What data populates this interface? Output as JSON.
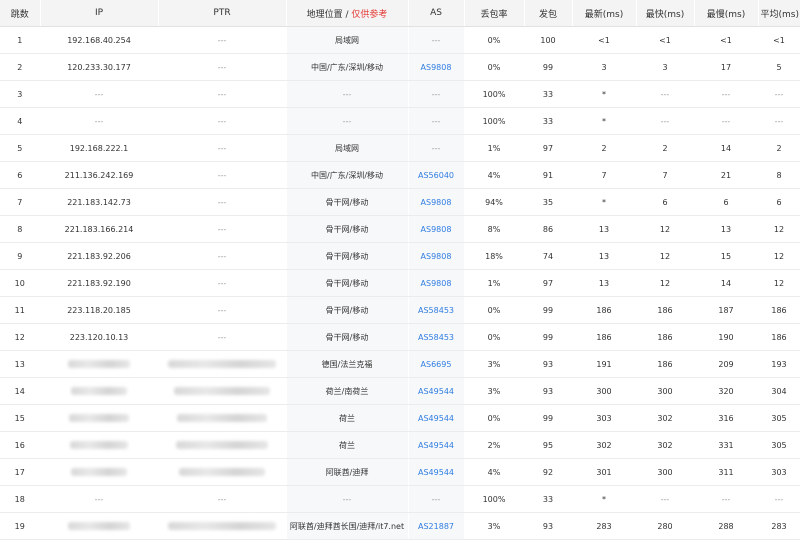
{
  "header": {
    "hop": "跳数",
    "ip": "IP",
    "ptr": "PTR",
    "geo": "地理位置 /",
    "geo_hint": "仅供参考",
    "as": "AS",
    "loss": "丢包率",
    "sent": "发包",
    "last": "最新(ms)",
    "best": "最快(ms)",
    "worst": "最慢(ms)",
    "avg": "平均(ms)"
  },
  "rows": [
    {
      "hop": "1",
      "ip": "192.168.40.254",
      "ptr": "---",
      "geo": "局域网",
      "as": "---",
      "as_link": false,
      "loss": "0%",
      "sent": "100",
      "last": "<1",
      "best": "<1",
      "worst": "<1",
      "avg": "<1"
    },
    {
      "hop": "2",
      "ip": "120.233.30.177",
      "ptr": "---",
      "geo": "中国/广东/深圳/移动",
      "as": "AS9808",
      "as_link": true,
      "loss": "0%",
      "sent": "99",
      "last": "3",
      "best": "3",
      "worst": "17",
      "avg": "5"
    },
    {
      "hop": "3",
      "ip": "---",
      "ptr": "---",
      "geo": "---",
      "as": "---",
      "as_link": false,
      "loss": "100%",
      "sent": "33",
      "last": "*",
      "best": "---",
      "worst": "---",
      "avg": "---"
    },
    {
      "hop": "4",
      "ip": "---",
      "ptr": "---",
      "geo": "---",
      "as": "---",
      "as_link": false,
      "loss": "100%",
      "sent": "33",
      "last": "*",
      "best": "---",
      "worst": "---",
      "avg": "---"
    },
    {
      "hop": "5",
      "ip": "192.168.222.1",
      "ptr": "---",
      "geo": "局域网",
      "as": "---",
      "as_link": false,
      "loss": "1%",
      "sent": "97",
      "last": "2",
      "best": "2",
      "worst": "14",
      "avg": "2"
    },
    {
      "hop": "6",
      "ip": "211.136.242.169",
      "ptr": "---",
      "geo": "中国/广东/深圳/移动",
      "as": "AS56040",
      "as_link": true,
      "loss": "4%",
      "sent": "91",
      "last": "7",
      "best": "7",
      "worst": "21",
      "avg": "8"
    },
    {
      "hop": "7",
      "ip": "221.183.142.73",
      "ptr": "---",
      "geo": "骨干网/移动",
      "as": "AS9808",
      "as_link": true,
      "loss": "94%",
      "sent": "35",
      "last": "*",
      "best": "6",
      "worst": "6",
      "avg": "6"
    },
    {
      "hop": "8",
      "ip": "221.183.166.214",
      "ptr": "---",
      "geo": "骨干网/移动",
      "as": "AS9808",
      "as_link": true,
      "loss": "8%",
      "sent": "86",
      "last": "13",
      "best": "12",
      "worst": "13",
      "avg": "12"
    },
    {
      "hop": "9",
      "ip": "221.183.92.206",
      "ptr": "---",
      "geo": "骨干网/移动",
      "as": "AS9808",
      "as_link": true,
      "loss": "18%",
      "sent": "74",
      "last": "13",
      "best": "12",
      "worst": "15",
      "avg": "12"
    },
    {
      "hop": "10",
      "ip": "221.183.92.190",
      "ptr": "---",
      "geo": "骨干网/移动",
      "as": "AS9808",
      "as_link": true,
      "loss": "1%",
      "sent": "97",
      "last": "13",
      "best": "12",
      "worst": "14",
      "avg": "12"
    },
    {
      "hop": "11",
      "ip": "223.118.20.185",
      "ptr": "---",
      "geo": "骨干网/移动",
      "as": "AS58453",
      "as_link": true,
      "loss": "0%",
      "sent": "99",
      "last": "186",
      "best": "186",
      "worst": "187",
      "avg": "186"
    },
    {
      "hop": "12",
      "ip": "223.120.10.13",
      "ptr": "---",
      "geo": "骨干网/移动",
      "as": "AS58453",
      "as_link": true,
      "loss": "0%",
      "sent": "99",
      "last": "186",
      "best": "186",
      "worst": "190",
      "avg": "186"
    },
    {
      "hop": "13",
      "ip": "",
      "ptr": "",
      "geo": "德国/法兰克福",
      "as": "AS6695",
      "as_link": true,
      "loss": "3%",
      "sent": "93",
      "last": "191",
      "best": "186",
      "worst": "209",
      "avg": "193",
      "ip_blur": true,
      "ptr_blur": true
    },
    {
      "hop": "14",
      "ip": "",
      "ptr": "",
      "geo": "荷兰/南荷兰",
      "as": "AS49544",
      "as_link": true,
      "loss": "3%",
      "sent": "93",
      "last": "300",
      "best": "300",
      "worst": "320",
      "avg": "304",
      "ip_blur": true,
      "ptr_blur": true
    },
    {
      "hop": "15",
      "ip": "",
      "ptr": "",
      "geo": "荷兰",
      "as": "AS49544",
      "as_link": true,
      "loss": "0%",
      "sent": "99",
      "last": "303",
      "best": "302",
      "worst": "316",
      "avg": "305",
      "ip_blur": true,
      "ptr_blur": true
    },
    {
      "hop": "16",
      "ip": "",
      "ptr": "",
      "geo": "荷兰",
      "as": "AS49544",
      "as_link": true,
      "loss": "2%",
      "sent": "95",
      "last": "302",
      "best": "302",
      "worst": "331",
      "avg": "305",
      "ip_blur": true,
      "ptr_blur": true
    },
    {
      "hop": "17",
      "ip": "",
      "ptr": "",
      "geo": "阿联酋/迪拜",
      "as": "AS49544",
      "as_link": true,
      "loss": "4%",
      "sent": "92",
      "last": "301",
      "best": "300",
      "worst": "311",
      "avg": "303",
      "ip_blur": true,
      "ptr_blur": true
    },
    {
      "hop": "18",
      "ip": "---",
      "ptr": "---",
      "geo": "---",
      "as": "---",
      "as_link": false,
      "loss": "100%",
      "sent": "33",
      "last": "*",
      "best": "---",
      "worst": "---",
      "avg": "---"
    },
    {
      "hop": "19",
      "ip": "",
      "ptr": "",
      "geo": "阿联酋/迪拜酋长国/迪拜/it7.net",
      "as": "AS21887",
      "as_link": true,
      "loss": "3%",
      "sent": "93",
      "last": "283",
      "best": "280",
      "worst": "288",
      "avg": "283",
      "ip_blur": true,
      "ptr_blur": true
    }
  ]
}
